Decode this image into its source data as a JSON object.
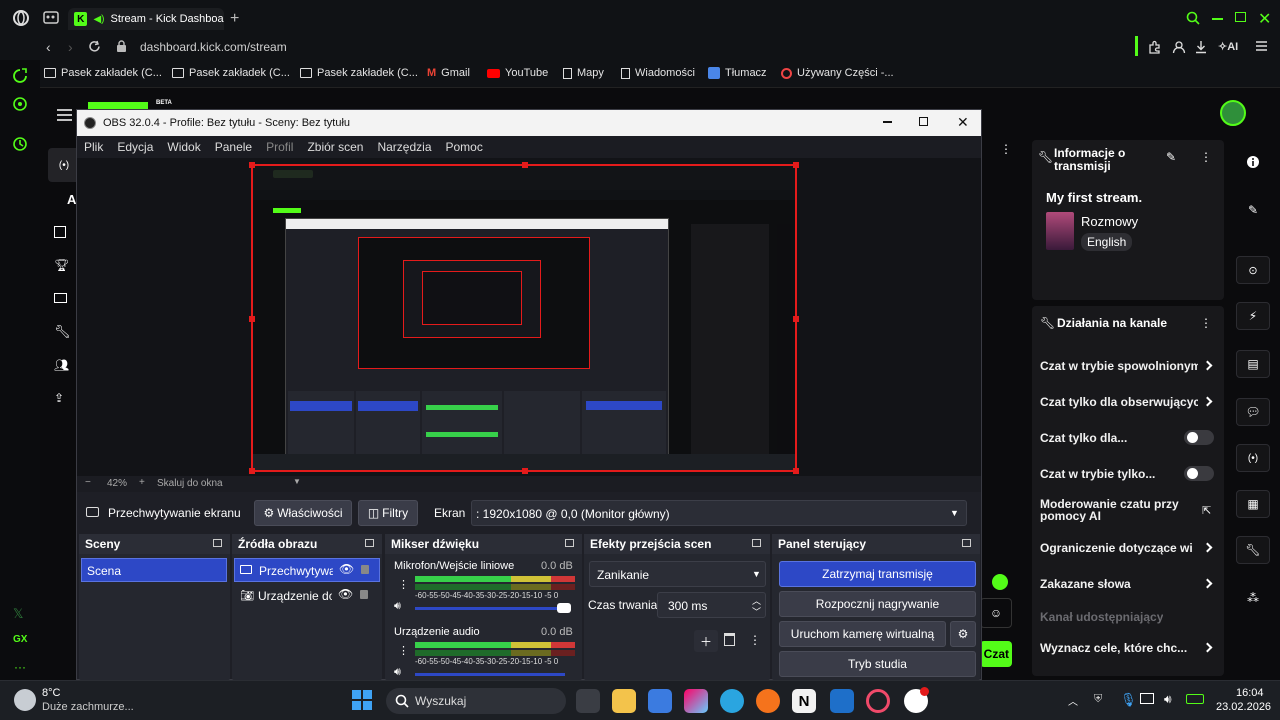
{
  "browser": {
    "tab_title": "Stream - Kick Dashboard",
    "url": "dashboard.kick.com/stream",
    "ai_label": "AI",
    "bookmarks": [
      "Pasek zakładek (C...",
      "Pasek zakładek (C...",
      "Pasek zakładek (C...",
      "Gmail",
      "YouTube",
      "Mapy",
      "Wiadomości",
      "Tłumacz",
      "Używany Części -..."
    ],
    "sidebar_gx": "GX",
    "kick_badge": "BETA"
  },
  "obs": {
    "window_title": "OBS 32.0.4 - Profile: Bez tytułu - Sceny: Bez tytułu",
    "menu": [
      "Plik",
      "Edycja",
      "Widok",
      "Panele",
      "Profil",
      "Zbiór scen",
      "Narzędzia",
      "Pomoc"
    ],
    "zoom": "42%",
    "scale_label": "Skaluj do okna",
    "source_bar": {
      "source_name": "Przechwytywanie ekranu",
      "properties": "Właściwości",
      "filters": "Filtry",
      "screen_label": "Ekran",
      "screen_value": ": 1920x1080 @ 0,0 (Monitor główny)"
    },
    "scenes": {
      "title": "Sceny",
      "items": [
        "Scena"
      ]
    },
    "sources": {
      "title": "Źródła obrazu",
      "items": [
        "Przechwytywa",
        "Urządzenie do"
      ]
    },
    "mixer": {
      "title": "Mikser dźwięku",
      "channels": [
        {
          "name": "Mikrofon/Wejście liniowe",
          "db": "0.0 dB"
        },
        {
          "name": "Urządzenie audio",
          "db": "0.0 dB"
        }
      ],
      "scale": "-60-55-50-45-40-35-30-25-20-15-10 -5 0"
    },
    "transitions": {
      "title": "Efekty przejścia scen",
      "effect": "Zanikanie",
      "duration_label": "Czas trwania",
      "duration_value": "300 ms"
    },
    "controls": {
      "title": "Panel sterujący",
      "stop_stream": "Zatrzymaj transmisję",
      "start_rec": "Rozpocznij nagrywanie",
      "virtual_cam": "Uruchom kamerę wirtualną",
      "studio": "Tryb studia"
    }
  },
  "kick": {
    "stream_info": {
      "title": "Informacje o transmisji",
      "stream_name": "My first stream.",
      "category": "Rozmowy",
      "language": "English"
    },
    "channel_actions": {
      "title": "Działania na kanale",
      "items": [
        {
          "label": "Czat w trybie spowolnionym",
          "kind": "chevron"
        },
        {
          "label": "Czat tylko dla obserwujących",
          "kind": "chevron"
        },
        {
          "label": "Czat tylko dla...",
          "kind": "toggle"
        },
        {
          "label": "Czat w trybie tylko...",
          "kind": "toggle"
        },
        {
          "label": "Moderowanie czatu przy pomocy AI",
          "kind": "external"
        },
        {
          "label": "Ograniczenie dotyczące wi",
          "kind": "chevron"
        },
        {
          "label": "Zakazane słowa",
          "kind": "chevron"
        },
        {
          "label": "Kanał udostępniający",
          "kind": "disabled"
        },
        {
          "label": "Wyznacz cele, które chc...",
          "kind": "chevron"
        }
      ]
    },
    "chat_button": "Czat",
    "left_letter": "A"
  },
  "taskbar": {
    "temperature": "8°C",
    "weather": "Duże zachmurze...",
    "search": "Wyszukaj",
    "time": "16:04",
    "date": "23.02.2026"
  },
  "colors": {
    "kick_green": "#53fc18",
    "obs_accent": "#2d48c6",
    "rec_red": "#e41b1b"
  }
}
